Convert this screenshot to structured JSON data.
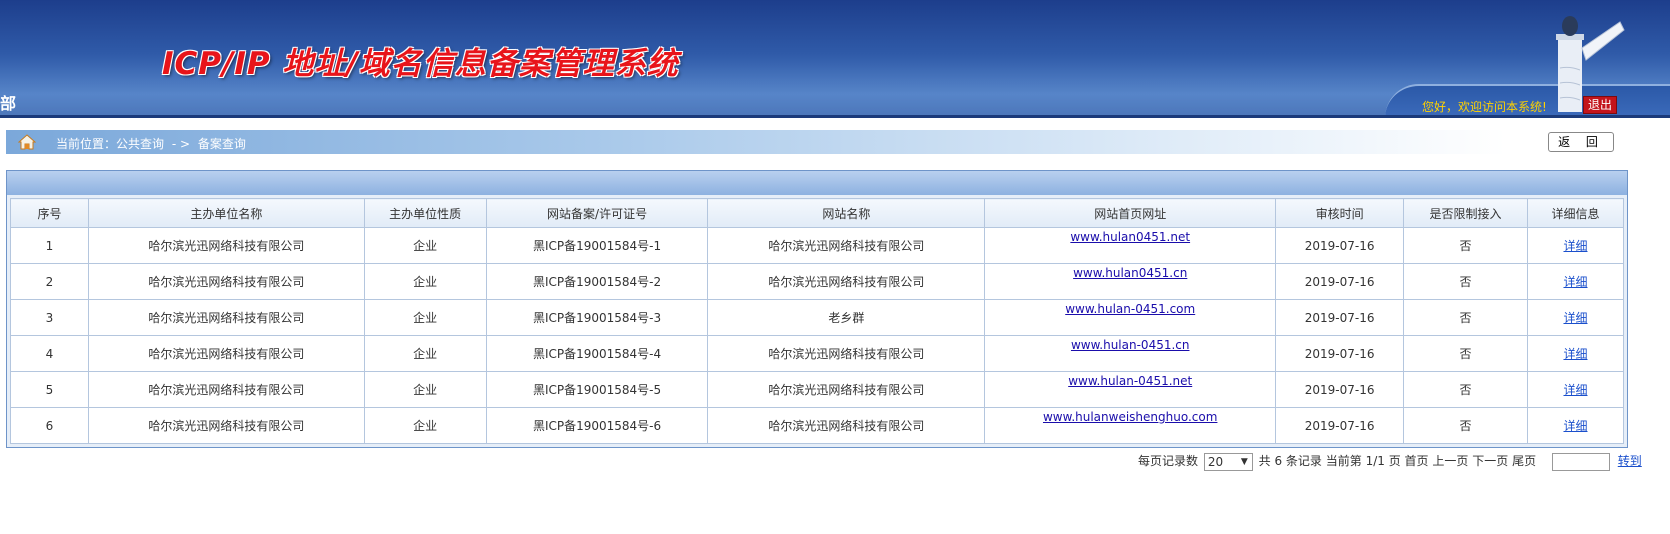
{
  "header": {
    "title": "ICP/IP 地址/域名信息备案管理系统",
    "dept_fragment": "部",
    "welcome": "您好，欢迎访问本系统!",
    "logout_label": "退出"
  },
  "breadcrumb": {
    "label": "当前位置：公共查询",
    "separator": "- >",
    "current": "备案查询"
  },
  "back_button": "返 回",
  "table": {
    "headers": [
      "序号",
      "主办单位名称",
      "主办单位性质",
      "网站备案/许可证号",
      "网站名称",
      "网站首页网址",
      "审核时间",
      "是否限制接入",
      "详细信息"
    ],
    "rows": [
      {
        "no": "1",
        "org": "哈尔滨光迅网络科技有限公司",
        "type": "企业",
        "license": "黑ICP备19001584号-1",
        "site": "哈尔滨光迅网络科技有限公司",
        "url": "www.hulan0451.net",
        "date": "2019-07-16",
        "limited": "否",
        "detail": "详细"
      },
      {
        "no": "2",
        "org": "哈尔滨光迅网络科技有限公司",
        "type": "企业",
        "license": "黑ICP备19001584号-2",
        "site": "哈尔滨光迅网络科技有限公司",
        "url": "www.hulan0451.cn",
        "date": "2019-07-16",
        "limited": "否",
        "detail": "详细"
      },
      {
        "no": "3",
        "org": "哈尔滨光迅网络科技有限公司",
        "type": "企业",
        "license": "黑ICP备19001584号-3",
        "site": "老乡群",
        "url": "www.hulan-0451.com",
        "date": "2019-07-16",
        "limited": "否",
        "detail": "详细"
      },
      {
        "no": "4",
        "org": "哈尔滨光迅网络科技有限公司",
        "type": "企业",
        "license": "黑ICP备19001584号-4",
        "site": "哈尔滨光迅网络科技有限公司",
        "url": "www.hulan-0451.cn",
        "date": "2019-07-16",
        "limited": "否",
        "detail": "详细"
      },
      {
        "no": "5",
        "org": "哈尔滨光迅网络科技有限公司",
        "type": "企业",
        "license": "黑ICP备19001584号-5",
        "site": "哈尔滨光迅网络科技有限公司",
        "url": "www.hulan-0451.net",
        "date": "2019-07-16",
        "limited": "否",
        "detail": "详细"
      },
      {
        "no": "6",
        "org": "哈尔滨光迅网络科技有限公司",
        "type": "企业",
        "license": "黑ICP备19001584号-6",
        "site": "哈尔滨光迅网络科技有限公司",
        "url": "www.hulanweishenghuo.com",
        "date": "2019-07-16",
        "limited": "否",
        "detail": "详细"
      }
    ]
  },
  "pager": {
    "per_page_label": "每页记录数",
    "per_page_value": "20",
    "total_text": "共 6 条记录",
    "current_text": "当前第 1/1 页",
    "first": "首页",
    "prev": "上一页",
    "next": "下一页",
    "last": "尾页",
    "goto": "转到"
  },
  "colors": {
    "header_blue": "#2f5aa8",
    "title_red": "#e8141a",
    "welcome_yellow": "#ffd200",
    "link_blue": "#1a4fcc"
  },
  "icons": [
    "home-icon",
    "monument-icon",
    "chevron-down-icon"
  ]
}
